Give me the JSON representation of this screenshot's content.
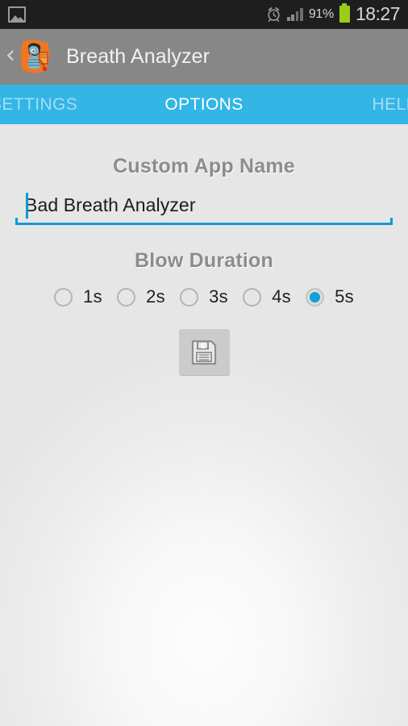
{
  "status_bar": {
    "notification_icon": "photo-icon",
    "alarm_icon": "alarm-clock-icon",
    "signal_icon": "signal-bars-icon",
    "battery_percent": "91%",
    "battery_icon": "battery-icon",
    "clock": "18:27",
    "background_color": "#1e1e1e",
    "battery_color": "#9bcc18"
  },
  "action_bar": {
    "back_icon": "back-chevron-icon",
    "app_icon": "app-logo-icon",
    "title": "Breath Analyzer",
    "background_color": "#878787"
  },
  "tabs": {
    "accent_color": "#33b5e5",
    "items": [
      {
        "label": "SETTINGS",
        "active": false
      },
      {
        "label": "OPTIONS",
        "active": true
      },
      {
        "label": "HELP",
        "active": false
      }
    ]
  },
  "main": {
    "custom_app_name": {
      "label": "Custom App Name",
      "value": "Bad Breath Analyzer",
      "placeholder": "Custom App Name",
      "caret_color": "#0f9bd7",
      "underline_color": "#0f9bd7"
    },
    "blow_duration": {
      "label": "Blow Duration",
      "selected": "5s",
      "options": [
        {
          "label": "1s",
          "checked": false
        },
        {
          "label": "2s",
          "checked": false
        },
        {
          "label": "3s",
          "checked": false
        },
        {
          "label": "4s",
          "checked": false
        },
        {
          "label": "5s",
          "checked": true
        }
      ],
      "checked_color": "#10a0d8"
    },
    "save_button": {
      "icon": "floppy-disk-save-icon",
      "label": ""
    }
  }
}
